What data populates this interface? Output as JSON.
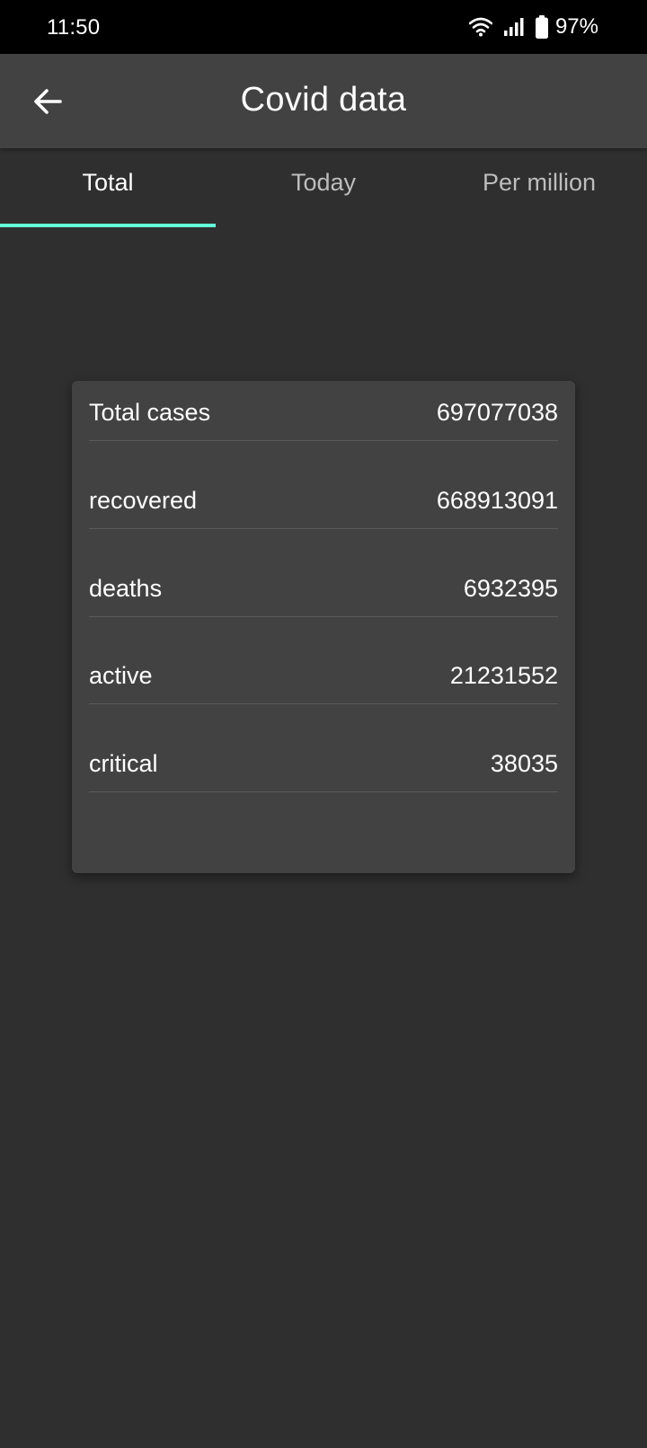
{
  "status_bar": {
    "time": "11:50",
    "battery_percent": "97%",
    "icons": [
      "wifi-icon",
      "signal-icon",
      "battery-icon"
    ]
  },
  "app_bar": {
    "title": "Covid data",
    "back_icon": "arrow-back-icon"
  },
  "tabs": [
    {
      "label": "Total",
      "active": true
    },
    {
      "label": "Today",
      "active": false
    },
    {
      "label": "Per million",
      "active": false
    }
  ],
  "stats": [
    {
      "label": "Total cases",
      "value": "697077038"
    },
    {
      "label": "recovered",
      "value": "668913091"
    },
    {
      "label": "deaths",
      "value": "6932395"
    },
    {
      "label": "active",
      "value": "21231552"
    },
    {
      "label": "critical",
      "value": "38035"
    }
  ],
  "colors": {
    "background": "#2f2f2f",
    "app_bar": "#424242",
    "card": "#424242",
    "accent": "#64ffda",
    "status_bar": "#000000"
  }
}
